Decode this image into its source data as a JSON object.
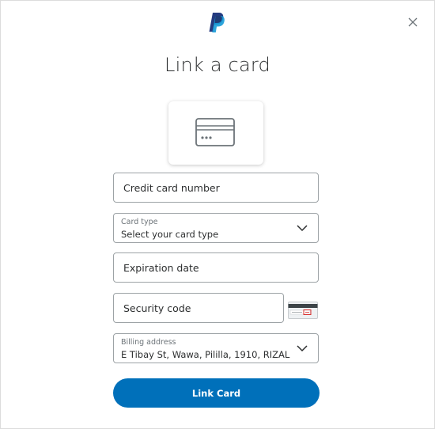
{
  "icons": {
    "logo": "paypal-logo",
    "close": "close-icon",
    "card": "credit-card-icon",
    "dropdown": "chevron-down-icon",
    "security_code_hint": "card-back-cvv-image"
  },
  "colors": {
    "brand_dark": "#253b80",
    "brand_light": "#179bd7",
    "primary_button": "#0070ba",
    "field_border": "#9da3a6"
  },
  "dialog": {
    "title": "Link a card"
  },
  "form": {
    "card_number": {
      "placeholder": "Credit card number"
    },
    "card_type": {
      "label": "Card type",
      "value": "Select your card type"
    },
    "expiration": {
      "placeholder": "Expiration date"
    },
    "security_code": {
      "placeholder": "Security code"
    },
    "billing_address": {
      "label": "Billing address",
      "value": "E Tibay St, Wawa, Pililla, 1910, RIZAL"
    }
  },
  "actions": {
    "submit_label": "Link Card"
  }
}
